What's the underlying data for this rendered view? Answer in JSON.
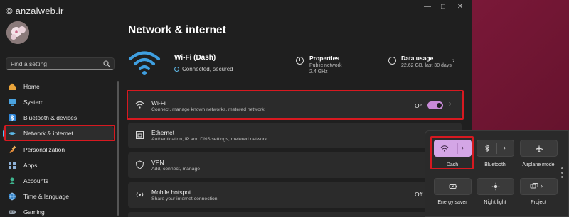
{
  "watermark": "© anzalweb.ir",
  "search": {
    "placeholder": "Find a setting"
  },
  "sidebar": {
    "items": [
      {
        "label": "Home",
        "icon": "home-icon"
      },
      {
        "label": "System",
        "icon": "monitor-icon"
      },
      {
        "label": "Bluetooth & devices",
        "icon": "bluetooth-icon"
      },
      {
        "label": "Network & internet",
        "icon": "network-icon",
        "active": true
      },
      {
        "label": "Personalization",
        "icon": "brush-icon"
      },
      {
        "label": "Apps",
        "icon": "apps-icon"
      },
      {
        "label": "Accounts",
        "icon": "person-icon"
      },
      {
        "label": "Time & language",
        "icon": "globe-icon"
      },
      {
        "label": "Gaming",
        "icon": "gamepad-icon"
      }
    ]
  },
  "main": {
    "title": "Network & internet",
    "hero": {
      "name": "Wi-Fi (Dash)",
      "status": "Connected, secured",
      "properties": {
        "title": "Properties",
        "line1": "Public network",
        "line2": "2.4 GHz"
      },
      "data_usage": {
        "title": "Data usage",
        "line1": "22.62 GB, last 30 days"
      }
    },
    "cards": [
      {
        "title": "Wi-Fi",
        "subtitle": "Connect, manage known networks, metered network",
        "state": "On",
        "icon": "wifi-icon"
      },
      {
        "title": "Ethernet",
        "subtitle": "Authentication, IP and DNS settings, metered network",
        "icon": "ethernet-icon"
      },
      {
        "title": "VPN",
        "subtitle": "Add, connect, manage",
        "icon": "shield-icon"
      },
      {
        "title": "Mobile hotspot",
        "subtitle": "Share your internet connection",
        "state": "Off",
        "icon": "hotspot-icon"
      }
    ]
  },
  "quick_settings": {
    "tiles": [
      {
        "label": "Dash",
        "icon": "wifi-icon",
        "on": true
      },
      {
        "label": "Bluetooth",
        "icon": "bluetooth-icon",
        "on": false
      },
      {
        "label": "Airplane mode",
        "icon": "airplane-icon",
        "on": false
      },
      {
        "label": "Energy saver",
        "icon": "battery-leaf-icon",
        "on": false
      },
      {
        "label": "Night light",
        "icon": "sun-icon",
        "on": false
      },
      {
        "label": "Project",
        "icon": "project-icon",
        "on": false
      }
    ]
  },
  "colors": {
    "accent": "#c98bd8",
    "highlight": "#d71920",
    "toggle_on": "#c98bd8"
  }
}
